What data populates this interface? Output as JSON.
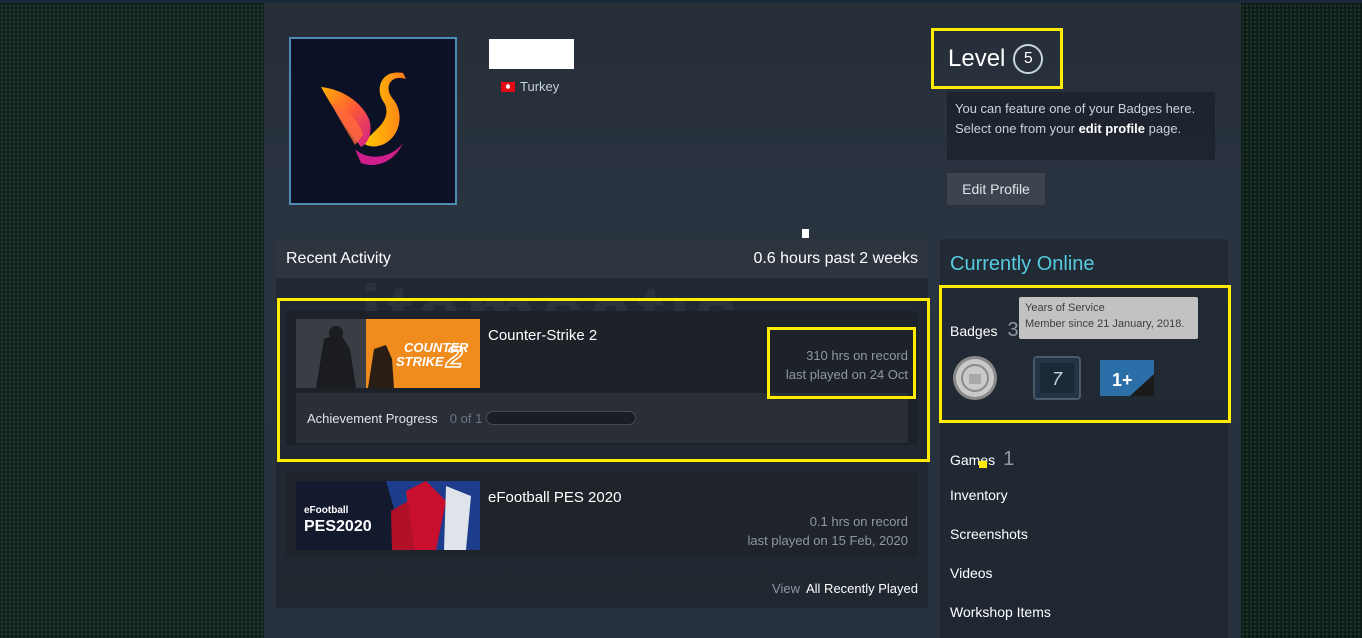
{
  "profile": {
    "country": "Turkey",
    "level_label": "Level",
    "level_value": "5",
    "badge_note_prefix": "You can feature one of your Badges here. Select one from your ",
    "badge_note_link": "edit profile",
    "badge_note_suffix": " page.",
    "edit_profile_label": "Edit Profile"
  },
  "activity": {
    "title": "Recent Activity",
    "hours_summary": "0.6 hours past 2 weeks",
    "games": [
      {
        "name": "Counter-Strike 2",
        "hours": "310 hrs on record",
        "last_played": "last played on 24 Oct",
        "thumb_text_1": "COUNTER",
        "thumb_text_2": "STRIKE",
        "thumb_text_3": "2",
        "achievement_label": "Achievement Progress",
        "achievement_count": "0 of 1",
        "achievement_progress": 0
      },
      {
        "name": "eFootball PES 2020",
        "hours": "0.1 hrs on record",
        "last_played": "last played on 15 Feb, 2020",
        "thumb_text_1": "eFootball",
        "thumb_text_2": "PES2020"
      }
    ],
    "view_label": "View",
    "view_all_label": "All Recently Played"
  },
  "sidebar": {
    "online_title": "Currently Online",
    "badges_label": "Badges",
    "badges_count": "3",
    "tooltip_title": "Years of Service",
    "tooltip_text": "Member since 21 January, 2018.",
    "badge_icons": [
      "years-of-service-icon",
      "seven-badge-icon",
      "one-plus-badge-icon"
    ],
    "badge_7_text": "7",
    "badge_1_text": "1+",
    "nav": [
      {
        "label": "Games",
        "count": "1"
      },
      {
        "label": "Inventory",
        "count": ""
      },
      {
        "label": "Screenshots",
        "count": ""
      },
      {
        "label": "Videos",
        "count": ""
      },
      {
        "label": "Workshop Items",
        "count": ""
      }
    ]
  },
  "watermark": "itemsatış",
  "colors": {
    "highlight": "#ffec00",
    "online": "#57cbde",
    "background": "#0e1a17"
  }
}
